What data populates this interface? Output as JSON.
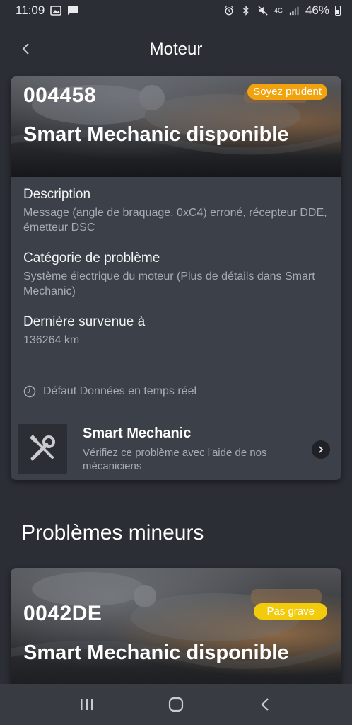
{
  "status_bar": {
    "time": "11:09",
    "network": "4G",
    "battery": "46%"
  },
  "header": {
    "title": "Moteur"
  },
  "card1": {
    "code": "004458",
    "badge": "Soyez prudent",
    "badge_color": "#f2a20c",
    "title": "Smart Mechanic disponible",
    "description_label": "Description",
    "description_value": "Message (angle de braquage, 0xC4) erroné, récepteur DDE, émetteur DSC",
    "category_label": "Catégorie de problème",
    "category_value": "Système électrique du moteur  (Plus de détails dans Smart Mechanic)",
    "last_label": "Dernière survenue à",
    "last_value": "136264 km",
    "live_text": "Défaut Données en temps réel",
    "smart_title": "Smart Mechanic",
    "smart_sub": "Vérifiez ce problème avec l'aide de nos mécaniciens"
  },
  "section": {
    "title": "Problèmes mineurs"
  },
  "card2": {
    "code": "0042DE",
    "badge": "Pas grave",
    "badge_color": "#f2cc0c",
    "title": "Smart Mechanic disponible"
  },
  "colors": {
    "background": "#2b2e35",
    "card": "#3c4048",
    "secondary_text": "#a7abb2"
  }
}
